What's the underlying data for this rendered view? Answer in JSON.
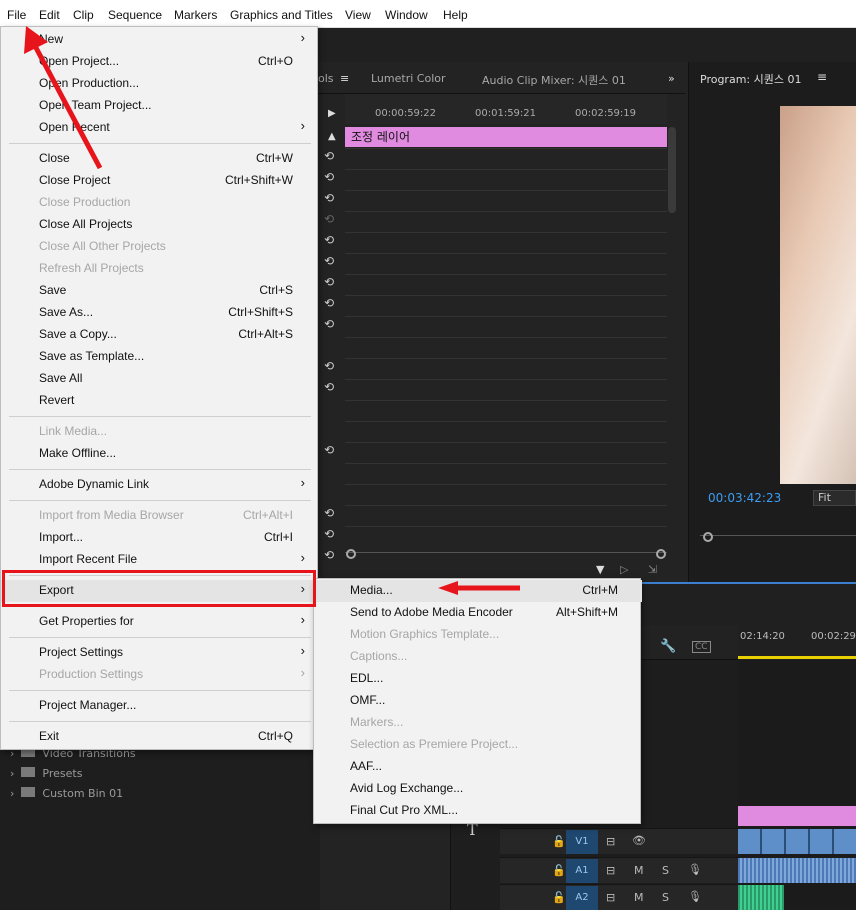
{
  "menubar": {
    "items": [
      "File",
      "Edit",
      "Clip",
      "Sequence",
      "Markers",
      "Graphics and Titles",
      "View",
      "Window",
      "Help"
    ]
  },
  "source_tabs": {
    "partial": "ols",
    "lumetri": "Lumetri Color",
    "mixer": "Audio Clip Mixer: 시퀀스 01"
  },
  "source_ruler": [
    "00:00:59:22",
    "00:01:59:21",
    "00:02:59:19"
  ],
  "adjustment_clip": "조정 레이어",
  "program": {
    "title": "Program: 시퀀스 01",
    "timecode": "00:03:42:23",
    "fit": "Fit"
  },
  "bin": {
    "items": [
      "Video Transitions",
      "Presets",
      "Custom Bin 01"
    ]
  },
  "timeline": {
    "ruler": [
      "02:14:20",
      "00:02:29:"
    ],
    "tracks": [
      {
        "label": "V1",
        "m": "",
        "s": ""
      },
      {
        "label": "A1",
        "m": "M",
        "s": "S"
      },
      {
        "label": "A2",
        "m": "M",
        "s": "S"
      }
    ]
  },
  "file_menu": {
    "items": [
      {
        "label": "New",
        "shortcut": "",
        "submenu": true,
        "disabled": false
      },
      {
        "label": "Open Project...",
        "shortcut": "Ctrl+O",
        "submenu": false,
        "disabled": false
      },
      {
        "label": "Open Production...",
        "shortcut": "",
        "submenu": false,
        "disabled": false
      },
      {
        "label": "Open Team Project...",
        "shortcut": "",
        "submenu": false,
        "disabled": false
      },
      {
        "label": "Open Recent",
        "shortcut": "",
        "submenu": true,
        "disabled": false
      },
      {
        "label": "Close",
        "shortcut": "Ctrl+W",
        "submenu": false,
        "disabled": false
      },
      {
        "label": "Close Project",
        "shortcut": "Ctrl+Shift+W",
        "submenu": false,
        "disabled": false
      },
      {
        "label": "Close Production",
        "shortcut": "",
        "submenu": false,
        "disabled": true
      },
      {
        "label": "Close All Projects",
        "shortcut": "",
        "submenu": false,
        "disabled": false
      },
      {
        "label": "Close All Other Projects",
        "shortcut": "",
        "submenu": false,
        "disabled": true
      },
      {
        "label": "Refresh All Projects",
        "shortcut": "",
        "submenu": false,
        "disabled": true
      },
      {
        "label": "Save",
        "shortcut": "Ctrl+S",
        "submenu": false,
        "disabled": false
      },
      {
        "label": "Save As...",
        "shortcut": "Ctrl+Shift+S",
        "submenu": false,
        "disabled": false
      },
      {
        "label": "Save a Copy...",
        "shortcut": "Ctrl+Alt+S",
        "submenu": false,
        "disabled": false
      },
      {
        "label": "Save as Template...",
        "shortcut": "",
        "submenu": false,
        "disabled": false
      },
      {
        "label": "Save All",
        "shortcut": "",
        "submenu": false,
        "disabled": false
      },
      {
        "label": "Revert",
        "shortcut": "",
        "submenu": false,
        "disabled": false
      },
      {
        "label": "Link Media...",
        "shortcut": "",
        "submenu": false,
        "disabled": true
      },
      {
        "label": "Make Offline...",
        "shortcut": "",
        "submenu": false,
        "disabled": false
      },
      {
        "label": "Adobe Dynamic Link",
        "shortcut": "",
        "submenu": true,
        "disabled": false
      },
      {
        "label": "Import from Media Browser",
        "shortcut": "Ctrl+Alt+I",
        "submenu": false,
        "disabled": true
      },
      {
        "label": "Import...",
        "shortcut": "Ctrl+I",
        "submenu": false,
        "disabled": false
      },
      {
        "label": "Import Recent File",
        "shortcut": "",
        "submenu": true,
        "disabled": false
      },
      {
        "label": "Export",
        "shortcut": "",
        "submenu": true,
        "disabled": false
      },
      {
        "label": "Get Properties for",
        "shortcut": "",
        "submenu": true,
        "disabled": false
      },
      {
        "label": "Project Settings",
        "shortcut": "",
        "submenu": true,
        "disabled": false
      },
      {
        "label": "Production Settings",
        "shortcut": "",
        "submenu": true,
        "disabled": true
      },
      {
        "label": "Project Manager...",
        "shortcut": "",
        "submenu": false,
        "disabled": false
      },
      {
        "label": "Exit",
        "shortcut": "Ctrl+Q",
        "submenu": false,
        "disabled": false
      }
    ]
  },
  "export_menu": {
    "items": [
      {
        "label": "Media...",
        "shortcut": "Ctrl+M",
        "disabled": false
      },
      {
        "label": "Send to Adobe Media Encoder",
        "shortcut": "Alt+Shift+M",
        "disabled": false
      },
      {
        "label": "Motion Graphics Template...",
        "shortcut": "",
        "disabled": true
      },
      {
        "label": "Captions...",
        "shortcut": "",
        "disabled": true
      },
      {
        "label": "EDL...",
        "shortcut": "",
        "disabled": false
      },
      {
        "label": "OMF...",
        "shortcut": "",
        "disabled": false
      },
      {
        "label": "Markers...",
        "shortcut": "",
        "disabled": true
      },
      {
        "label": "Selection as Premiere Project...",
        "shortcut": "",
        "disabled": true
      },
      {
        "label": "AAF...",
        "shortcut": "",
        "disabled": false
      },
      {
        "label": "Avid Log Exchange...",
        "shortcut": "",
        "disabled": false
      },
      {
        "label": "Final Cut Pro XML...",
        "shortcut": "",
        "disabled": false
      }
    ]
  },
  "colors": {
    "highlight_red": "#e8141b",
    "adjustment_clip": "#e08be0",
    "timecode_blue": "#3c9df2",
    "playhead_yellow": "#e8d000"
  }
}
